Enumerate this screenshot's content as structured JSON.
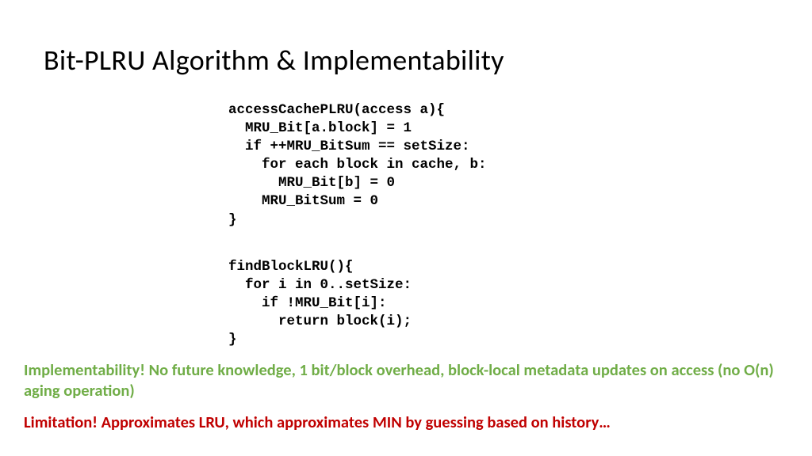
{
  "title": "Bit-PLRU Algorithm & Implementability",
  "code1": "accessCachePLRU(access a){\n  MRU_Bit[a.block] = 1\n  if ++MRU_BitSum == setSize:\n    for each block in cache, b:\n      MRU_Bit[b] = 0\n    MRU_BitSum = 0\n}",
  "code2": "findBlockLRU(){\n  for i in 0..setSize:\n    if !MRU_Bit[i]:\n      return block(i);\n}",
  "implementability": "Implementability! No future knowledge, 1 bit/block overhead, block-local metadata updates on access (no O(n) aging operation)",
  "limitation": "Limitation! Approximates LRU, which approximates MIN by guessing based on history…"
}
